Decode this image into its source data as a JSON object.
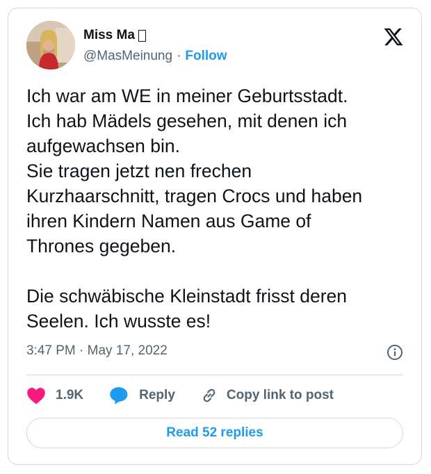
{
  "author": {
    "display_name": "Miss Ma",
    "handle": "@MasMeinung",
    "separator": "·",
    "follow_label": "Follow",
    "avatar_icon": "profile-photo"
  },
  "brand_icon": "x-logo-icon",
  "tweet": {
    "text": "Ich war am WE in meiner Geburtsstadt.\nIch hab Mädels gesehen, mit denen ich\naufgewachsen bin.\nSie tragen jetzt nen frechen\nKurzhaarschnitt, tragen Crocs und haben\nihren Kindern Namen aus Game of\nThrones gegeben.\n\nDie schwäbische Kleinstadt frisst deren\nSeelen. Ich wusste es!",
    "timestamp": "3:47 PM · May 17, 2022"
  },
  "actions": {
    "likes": "1.9K",
    "reply_label": "Reply",
    "copy_label": "Copy link to post"
  },
  "read_replies_label": "Read 52 replies",
  "colors": {
    "accent": "#1d9bf0",
    "like": "#f91880",
    "text": "#0f1419",
    "muted": "#536471",
    "border": "#cfd9de"
  }
}
